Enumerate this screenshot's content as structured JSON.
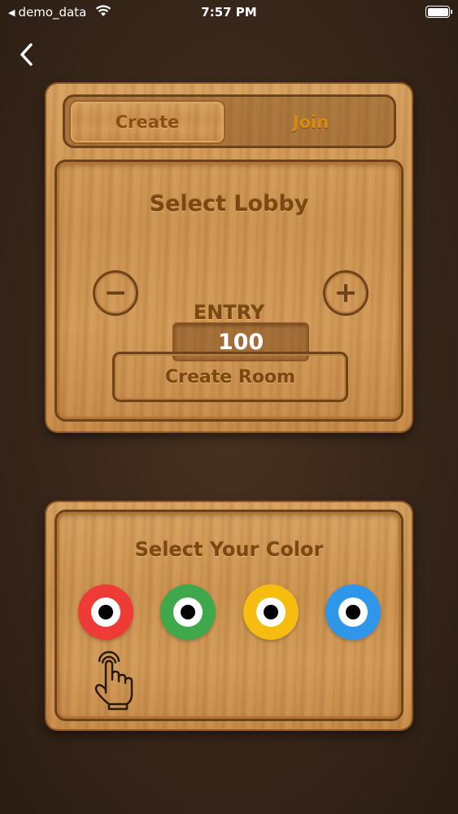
{
  "status_bar": {
    "back_app": "demo_data",
    "time": "7:57 PM"
  },
  "tabs": [
    {
      "label": "Create",
      "selected": true
    },
    {
      "label": "Join",
      "selected": false
    }
  ],
  "lobby": {
    "title": "Select Lobby",
    "entry_value": "100",
    "entry_label": "ENTRY",
    "create_room_label": "Create Room"
  },
  "color_picker": {
    "title": "Select Your Color",
    "colors": [
      {
        "name": "red",
        "hex": "#ee3b35"
      },
      {
        "name": "green",
        "hex": "#3fa84b"
      },
      {
        "name": "yellow",
        "hex": "#f6bc0f"
      },
      {
        "name": "blue",
        "hex": "#2f97ea"
      }
    ],
    "selected": "red"
  },
  "icons": [
    "chevron-left-icon",
    "wifi-icon",
    "battery-icon",
    "minus-icon",
    "plus-icon",
    "tap-hand-icon"
  ]
}
